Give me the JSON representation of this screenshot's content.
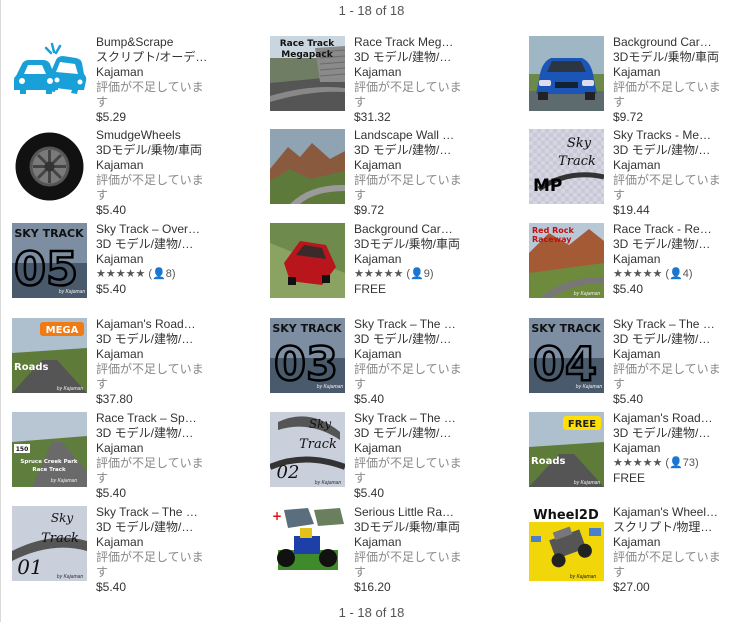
{
  "pagination": {
    "top": "1 - 18 of 18",
    "bottom": "1 - 18 of 18"
  },
  "items": [
    {
      "title": "Bump&Scrape",
      "category": "スクリプト/オーデ…",
      "publisher": "Kajaman",
      "rating": "評価が不足しています",
      "price": "$5.29",
      "thumb": "crash-icon"
    },
    {
      "title": "Race Track Meg…",
      "category": "3D モデル/建物/…",
      "publisher": "Kajaman",
      "rating": "評価が不足しています",
      "price": "$31.32",
      "thumb": "race-track-megapack",
      "thumb_text": [
        "Race Track",
        "Megapack"
      ]
    },
    {
      "title": "Background Car…",
      "category": "3Dモデル/乗物/車両",
      "publisher": "Kajaman",
      "rating": "評価が不足しています",
      "price": "$9.72",
      "thumb": "blue-car"
    },
    {
      "title": "SmudgeWheels",
      "category": "3Dモデル/乗物/車両",
      "publisher": "Kajaman",
      "rating": "評価が不足しています",
      "price": "$5.40",
      "thumb": "wheel"
    },
    {
      "title": "Landscape Wall …",
      "category": "3D モデル/建物/…",
      "publisher": "Kajaman",
      "rating": "評価が不足しています",
      "price": "$9.72",
      "thumb": "landscape"
    },
    {
      "title": "Sky Tracks - Me…",
      "category": "3D モデル/建物/…",
      "publisher": "Kajaman",
      "rating": "評価が不足しています",
      "price": "$19.44",
      "thumb": "sky-track-mp",
      "thumb_text": [
        "Sky",
        "Track",
        "MP"
      ]
    },
    {
      "title": "Sky Track – Over…",
      "category": "3D モデル/建物/…",
      "publisher": "Kajaman",
      "stars": "★★★★★",
      "count": "8",
      "price": "$5.40",
      "thumb": "sky-track-05",
      "thumb_text": [
        "SKY TRACK",
        "05",
        "by Kajaman"
      ]
    },
    {
      "title": "Background Car…",
      "category": "3Dモデル/乗物/車両",
      "publisher": "Kajaman",
      "stars": "★★★★★",
      "count": "9",
      "price": "FREE",
      "thumb": "red-car"
    },
    {
      "title": "Race Track - Re…",
      "category": "3D モデル/建物/…",
      "publisher": "Kajaman",
      "stars": "★★★★★",
      "count": "4",
      "price": "$5.40",
      "thumb": "red-rock",
      "thumb_text": [
        "Red Rock",
        "Raceway",
        "by Kajaman"
      ]
    },
    {
      "title": "Kajaman's Road…",
      "category": "3D モデル/建物/…",
      "publisher": "Kajaman",
      "rating": "評価が不足しています",
      "price": "$37.80",
      "thumb": "mega-roads",
      "thumb_text": [
        "MEGA",
        "Roads",
        "by Kajaman"
      ]
    },
    {
      "title": "Sky Track – The …",
      "category": "3D モデル/建物/…",
      "publisher": "Kajaman",
      "rating": "評価が不足しています",
      "price": "$5.40",
      "thumb": "sky-track-03",
      "thumb_text": [
        "SKY TRACK",
        "03",
        "by Kajaman"
      ]
    },
    {
      "title": "Sky Track – The …",
      "category": "3D モデル/建物/…",
      "publisher": "Kajaman",
      "rating": "評価が不足しています",
      "price": "$5.40",
      "thumb": "sky-track-04",
      "thumb_text": [
        "SKY TRACK",
        "04",
        "by Kajaman"
      ]
    },
    {
      "title": "Race Track – Sp…",
      "category": "3D モデル/建物/…",
      "publisher": "Kajaman",
      "rating": "評価が不足しています",
      "price": "$5.40",
      "thumb": "spruce-creek",
      "thumb_text": [
        "150",
        "Spruce Creek Park",
        "Race Track",
        "by Kajaman"
      ]
    },
    {
      "title": "Sky Track – The …",
      "category": "3D モデル/建物/…",
      "publisher": "Kajaman",
      "rating": "評価が不足しています",
      "price": "$5.40",
      "thumb": "sky-track-02",
      "thumb_text": [
        "Sky",
        "Track",
        "02",
        "by Kajaman"
      ]
    },
    {
      "title": "Kajaman's Road…",
      "category": "3D モデル/建物/…",
      "publisher": "Kajaman",
      "stars": "★★★★★",
      "count": "73",
      "price": "FREE",
      "thumb": "free-roads",
      "thumb_text": [
        "FREE",
        "Roads",
        "by Kajaman"
      ]
    },
    {
      "title": "Sky Track – The …",
      "category": "3D モデル/建物/…",
      "publisher": "Kajaman",
      "rating": "評価が不足しています",
      "price": "$5.40",
      "thumb": "sky-track-01",
      "thumb_text": [
        "Sky",
        "Track",
        "01",
        "by Kajaman"
      ]
    },
    {
      "title": "Serious Little Ra…",
      "category": "3Dモデル/乗物/車両",
      "publisher": "Kajaman",
      "rating": "評価が不足しています",
      "price": "$16.20",
      "thumb": "little-racer",
      "thumb_text": [
        "by Kajaman"
      ]
    },
    {
      "title": "Kajaman's Wheel…",
      "category": "スクリプト/物理…",
      "publisher": "Kajaman",
      "rating": "評価が不足しています",
      "price": "$27.00",
      "thumb": "wheel2d",
      "thumb_text": [
        "Wheel2D",
        "by Kajaman"
      ]
    }
  ]
}
